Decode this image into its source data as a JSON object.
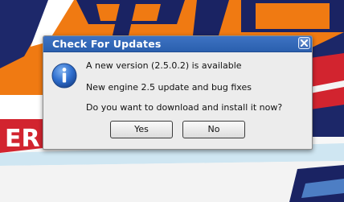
{
  "dialog": {
    "title": "Check For Updates",
    "close_icon": "close-icon",
    "icon": "info-icon",
    "line1": "A new version (2.5.0.2) is available",
    "line2": "New engine 2.5 update and bug fixes",
    "line3": "Do you want to download and install it now?",
    "yes_label": "Yes",
    "no_label": "No"
  },
  "background": {
    "banner_text": "ER"
  },
  "colors": {
    "titlebar": "#2f63b2",
    "background_orange": "#f07a12",
    "background_navy": "#1f2a6b",
    "background_banner_red": "#d2242f"
  }
}
